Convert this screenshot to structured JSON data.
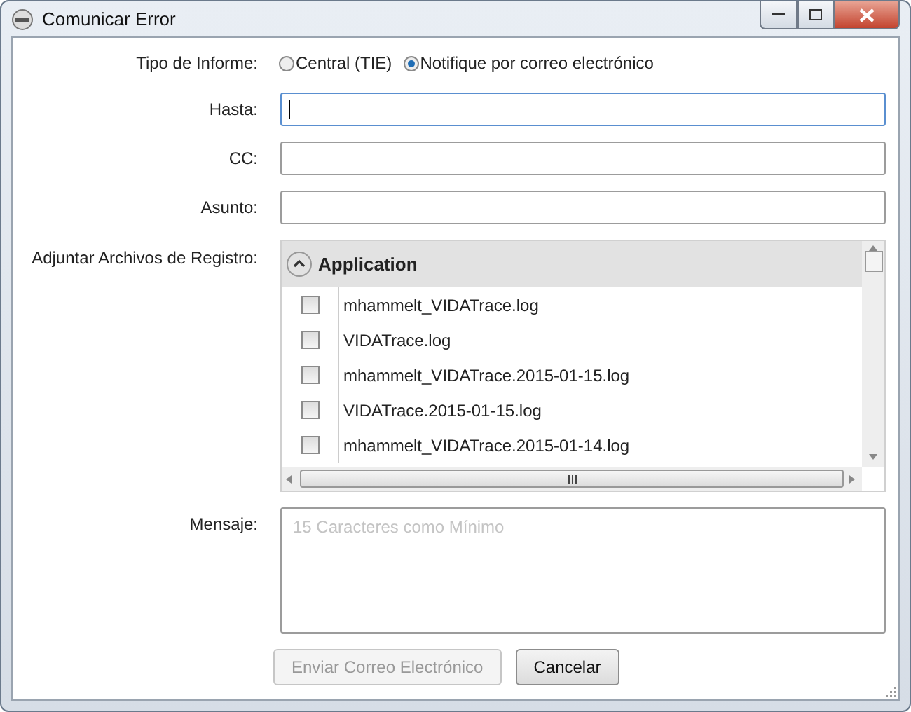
{
  "window": {
    "title": "Comunicar Error"
  },
  "report_type": {
    "label": "Tipo de Informe:",
    "options": [
      {
        "label": "Central (TIE)",
        "selected": false
      },
      {
        "label": "Notifique por correo electrónico",
        "selected": true
      }
    ]
  },
  "fields": [
    {
      "label": "Hasta:",
      "focused": true
    },
    {
      "label": "CC:",
      "focused": false
    },
    {
      "label": "Asunto:",
      "focused": false
    }
  ],
  "attachments": {
    "label": "Adjuntar Archivos de Registro:",
    "group": {
      "title": "Application",
      "expanded": true
    },
    "files": [
      {
        "name": "mhammelt_VIDATrace.log",
        "checked": false
      },
      {
        "name": "VIDATrace.log",
        "checked": false
      },
      {
        "name": "mhammelt_VIDATrace.2015-01-15.log",
        "checked": false
      },
      {
        "name": "VIDATrace.2015-01-15.log",
        "checked": false
      },
      {
        "name": "mhammelt_VIDATrace.2015-01-14.log",
        "checked": false
      }
    ]
  },
  "message": {
    "label": "Mensaje:",
    "placeholder": "15 Caracteres como Mínimo"
  },
  "buttons": [
    {
      "label": "Enviar Correo Electrónico",
      "disabled": true
    },
    {
      "label": "Cancelar",
      "disabled": false
    }
  ]
}
